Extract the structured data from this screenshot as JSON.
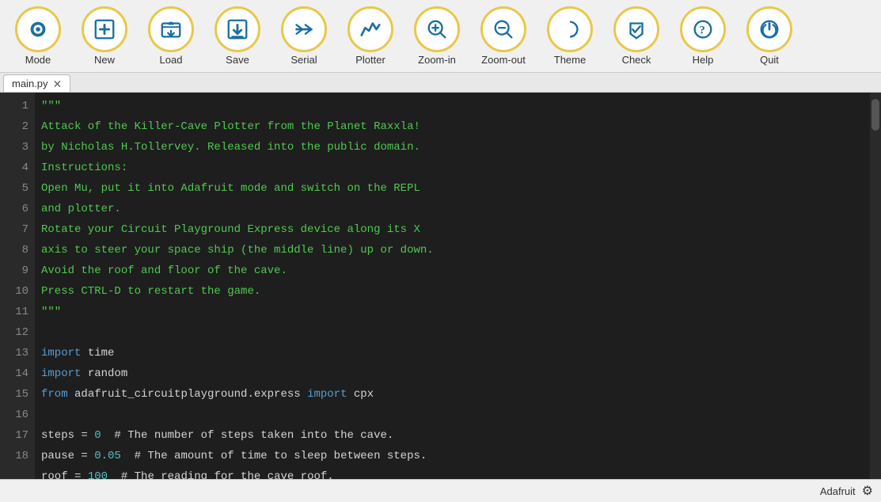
{
  "toolbar": {
    "buttons": [
      {
        "id": "mode",
        "label": "Mode",
        "icon": "mode"
      },
      {
        "id": "new",
        "label": "New",
        "icon": "new"
      },
      {
        "id": "load",
        "label": "Load",
        "icon": "load"
      },
      {
        "id": "save",
        "label": "Save",
        "icon": "save"
      },
      {
        "id": "serial",
        "label": "Serial",
        "icon": "serial"
      },
      {
        "id": "plotter",
        "label": "Plotter",
        "icon": "plotter"
      },
      {
        "id": "zoom-in",
        "label": "Zoom-in",
        "icon": "zoom-in"
      },
      {
        "id": "zoom-out",
        "label": "Zoom-out",
        "icon": "zoom-out"
      },
      {
        "id": "theme",
        "label": "Theme",
        "icon": "theme"
      },
      {
        "id": "check",
        "label": "Check",
        "icon": "check"
      },
      {
        "id": "help",
        "label": "Help",
        "icon": "help"
      },
      {
        "id": "quit",
        "label": "Quit",
        "icon": "quit"
      }
    ]
  },
  "tab": {
    "filename": "main.py"
  },
  "statusbar": {
    "mode": "Adafruit",
    "gear_icon": "⚙"
  },
  "lines": [
    {
      "num": 1,
      "content": "\"\"\""
    },
    {
      "num": 2,
      "content": "Attack of the Killer-Cave Plotter from the Planet Raxxla!"
    },
    {
      "num": 3,
      "content": "by Nicholas H.Tollervey. Released into the public domain."
    },
    {
      "num": 4,
      "content": "Instructions:"
    },
    {
      "num": 5,
      "content": "Open Mu, put it into Adafruit mode and switch on the REPL"
    },
    {
      "num": 6,
      "content": "and plotter."
    },
    {
      "num": 7,
      "content": "Rotate your Circuit Playground Express device along its X"
    },
    {
      "num": 8,
      "content": "axis to steer your space ship (the middle line) up or down."
    },
    {
      "num": 9,
      "content": "Avoid the roof and floor of the cave."
    },
    {
      "num": 10,
      "content": "Press CTRL-D to restart the game."
    },
    {
      "num": 11,
      "content": "\"\"\""
    },
    {
      "num": 12,
      "content": ""
    },
    {
      "num": 13,
      "content": ""
    },
    {
      "num": 14,
      "content": ""
    },
    {
      "num": 15,
      "content": ""
    },
    {
      "num": 16,
      "content": ""
    },
    {
      "num": 17,
      "content": ""
    },
    {
      "num": 18,
      "content": ""
    }
  ]
}
